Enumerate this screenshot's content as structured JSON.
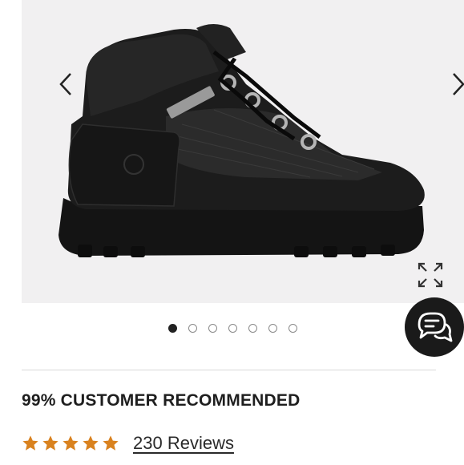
{
  "gallery": {
    "image_alt": "Black leather boot with mesh panel and metal lace hooks",
    "prev_icon": "chevron-left-icon",
    "next_icon": "chevron-right-icon",
    "expand_icon": "expand-icon",
    "dot_count": 7,
    "active_dot": 0,
    "background_color": "#f1f0f1"
  },
  "chat": {
    "icon": "chat-bubbles-icon",
    "color": "#1a1a1a"
  },
  "product": {
    "recommend_text": "99% CUSTOMER RECOMMENDED",
    "rating": 5,
    "star_color": "#d9821f",
    "reviews_link": "230 Reviews"
  }
}
